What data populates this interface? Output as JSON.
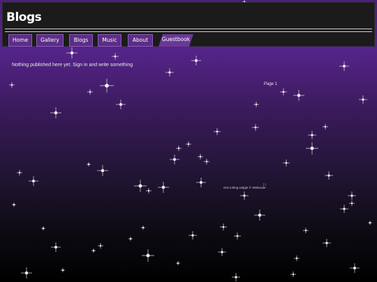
{
  "site": {
    "title": "Blogs"
  },
  "nav": {
    "items": [
      {
        "label": "Home"
      },
      {
        "label": "Gallery"
      },
      {
        "label": "Blogs"
      },
      {
        "label": "Music"
      },
      {
        "label": "About"
      },
      {
        "label": "Guestbook"
      }
    ]
  },
  "content": {
    "empty_message": "Nothing published here yet. Sign in and write something",
    "pager": "Page 1"
  },
  "widget": {
    "text": "Get a Blog widget  ©  Webnode",
    "icon": "rss-icon"
  },
  "colors": {
    "nav_button": "#5c2e86",
    "top_bar": "#1b1b1b",
    "background_top": "#4a1f7a",
    "background_bottom": "#000000"
  }
}
